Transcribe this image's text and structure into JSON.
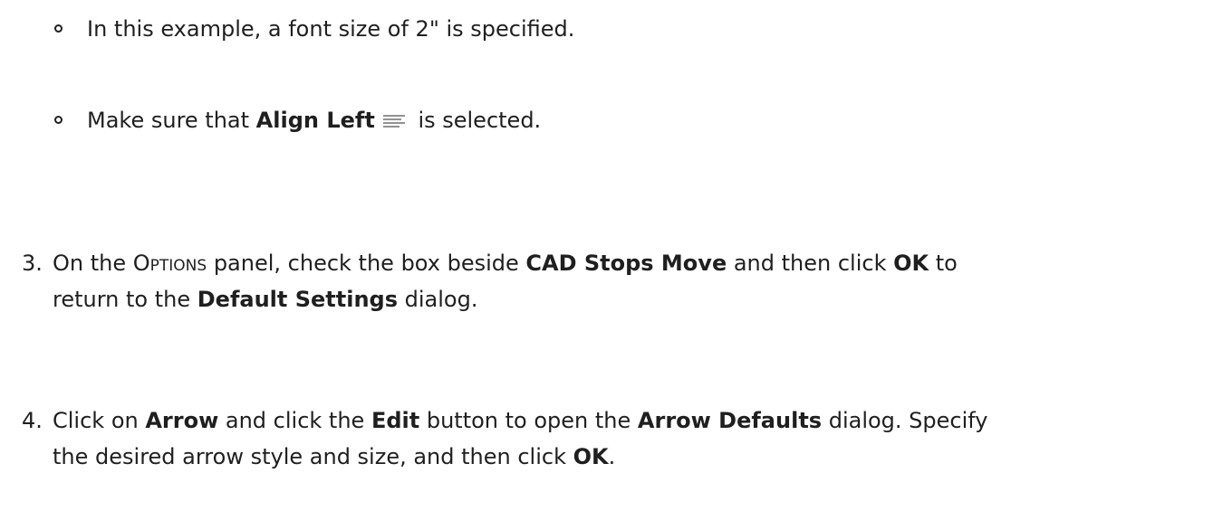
{
  "sub_bullets": [
    {
      "text": "In this example, a font size of 2\" is specified."
    },
    {
      "pre": "Make sure that ",
      "bold": "Align Left",
      "icon": "align-left-icon",
      "post": " is selected."
    }
  ],
  "steps": [
    {
      "number": "3.",
      "line1_a": "On the ",
      "line1_sc": "Options",
      "line1_b": " panel, check the box beside ",
      "line1_bold1": "CAD Stops Move",
      "line1_c": " and then click ",
      "line1_bold2": "OK",
      "line1_d": " to",
      "line2_a": "return to the ",
      "line2_bold": "Default Settings",
      "line2_b": " dialog."
    },
    {
      "number": "4.",
      "line1_a": "Click on ",
      "line1_bold1": "Arrow",
      "line1_b": " and click the ",
      "line1_bold2": "Edit",
      "line1_c": " button to open the ",
      "line1_bold3": "Arrow Defaults",
      "line1_d": " dialog. Specify",
      "line2_a": "the desired arrow style and size, and then click ",
      "line2_bold": "OK",
      "line2_b": "."
    }
  ]
}
